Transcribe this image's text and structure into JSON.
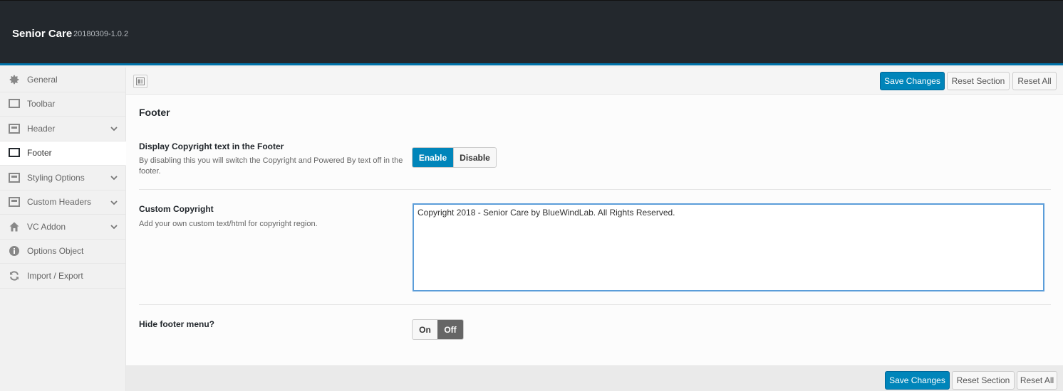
{
  "header": {
    "title": "Senior Care",
    "version": "20180309-1.0.2"
  },
  "sidebar": {
    "items": [
      {
        "label": "General",
        "icon": "gear-icon",
        "expandable": false,
        "active": false
      },
      {
        "label": "Toolbar",
        "icon": "monitor-icon",
        "expandable": false,
        "active": false
      },
      {
        "label": "Header",
        "icon": "layout-icon",
        "expandable": true,
        "active": false
      },
      {
        "label": "Footer",
        "icon": "monitor-icon",
        "expandable": false,
        "active": true
      },
      {
        "label": "Styling Options",
        "icon": "layout-icon",
        "expandable": true,
        "active": false
      },
      {
        "label": "Custom Headers",
        "icon": "layout-icon",
        "expandable": true,
        "active": false
      },
      {
        "label": "VC Addon",
        "icon": "home-icon",
        "expandable": true,
        "active": false
      },
      {
        "label": "Options Object",
        "icon": "info-icon",
        "expandable": false,
        "active": false
      },
      {
        "label": "Import / Export",
        "icon": "refresh-icon",
        "expandable": false,
        "active": false
      }
    ]
  },
  "toolbar": {
    "save_label": "Save Changes",
    "reset_section_label": "Reset Section",
    "reset_all_label": "Reset All"
  },
  "section": {
    "title": "Footer",
    "fields": {
      "copyright_display": {
        "title": "Display Copyright text in the Footer",
        "description": "By disabling this you will switch the Copyright and Powered By text off in the footer.",
        "enable_label": "Enable",
        "disable_label": "Disable",
        "value": "Enable"
      },
      "custom_copyright": {
        "title": "Custom Copyright",
        "description": "Add your own custom text/html for copyright region.",
        "value": "Copyright 2018 - Senior Care by BlueWindLab. All Rights Reserved."
      },
      "hide_footer_menu": {
        "title": "Hide footer menu?",
        "on_label": "On",
        "off_label": "Off",
        "value": "Off"
      }
    }
  },
  "colors": {
    "accent": "#0085ba",
    "header_bg": "#23282d",
    "header_border": "#0073aa"
  }
}
